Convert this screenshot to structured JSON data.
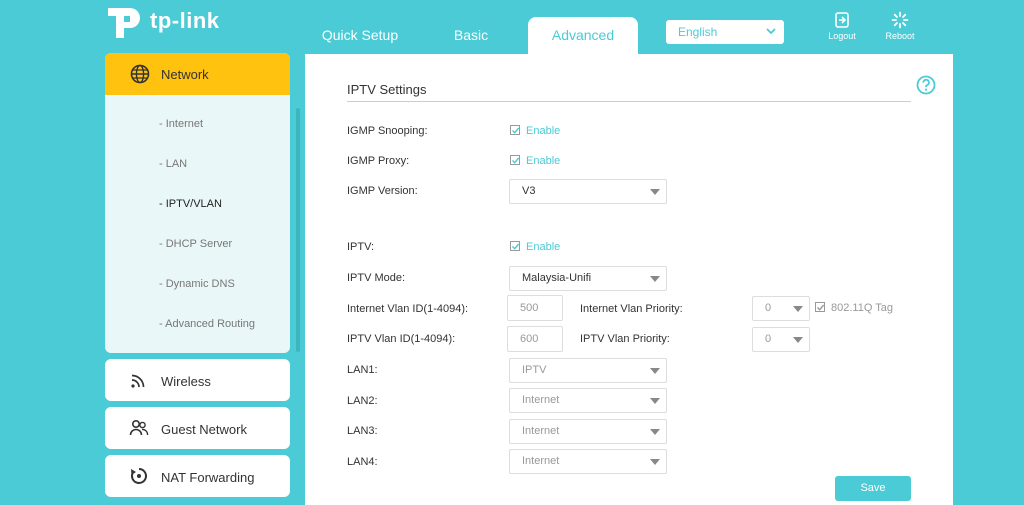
{
  "brand": {
    "name": "tp-link"
  },
  "tabs": {
    "quick_setup": "Quick Setup",
    "basic": "Basic",
    "advanced": "Advanced"
  },
  "language": {
    "selected": "English"
  },
  "header_actions": {
    "logout": "Logout",
    "reboot": "Reboot"
  },
  "sidebar": {
    "network": {
      "label": "Network",
      "sub_items": [
        "- Internet",
        "- LAN",
        "- IPTV/VLAN",
        "- DHCP Server",
        "- Dynamic DNS",
        "- Advanced Routing"
      ],
      "active_sub": "- IPTV/VLAN"
    },
    "wireless": "Wireless",
    "guest_network": "Guest Network",
    "nat_forwarding": "NAT Forwarding"
  },
  "iptv": {
    "title": "IPTV Settings",
    "igmp_snooping": {
      "label": "IGMP Snooping:",
      "checkbox": "Enable",
      "checked": true
    },
    "igmp_proxy": {
      "label": "IGMP Proxy:",
      "checkbox": "Enable",
      "checked": true
    },
    "igmp_version": {
      "label": "IGMP Version:",
      "value": "V3"
    },
    "iptv": {
      "label": "IPTV:",
      "checkbox": "Enable",
      "checked": true
    },
    "iptv_mode": {
      "label": "IPTV Mode:",
      "value": "Malaysia-Unifi"
    },
    "internet_vlan_id": {
      "label": "Internet Vlan ID(1-4094):",
      "value": "500"
    },
    "internet_vlan_priority": {
      "label": "Internet Vlan Priority:",
      "value": "0"
    },
    "tag_8021q": {
      "label": "802.11Q Tag",
      "checked": true
    },
    "iptv_vlan_id": {
      "label": "IPTV Vlan ID(1-4094):",
      "value": "600"
    },
    "iptv_vlan_priority": {
      "label": "IPTV Vlan Priority:",
      "value": "0"
    },
    "lan1": {
      "label": "LAN1:",
      "value": "IPTV"
    },
    "lan2": {
      "label": "LAN2:",
      "value": "Internet"
    },
    "lan3": {
      "label": "LAN3:",
      "value": "Internet"
    },
    "lan4": {
      "label": "LAN4:",
      "value": "Internet"
    },
    "save": "Save"
  },
  "colors": {
    "teal": "#4acbd6",
    "yellow": "#ffc20e"
  }
}
